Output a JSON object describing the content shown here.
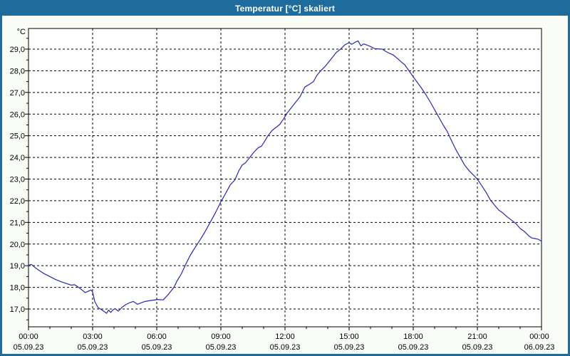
{
  "window": {
    "title": "Temperatur [°C] skaliert"
  },
  "colors": {
    "titlebar_bg": "#1e6c9d",
    "window_border": "#1e6c9d",
    "title_text": "#ffffff",
    "page_bg": "#fafdf7",
    "plot_bg": "#ffffff",
    "grid": "#000000",
    "axis": "#000000",
    "label_text": "#000000",
    "line": "#2828b4"
  },
  "chart": {
    "unit_label": "°C",
    "y_ticks": [
      {
        "value": 29,
        "label": "29,0"
      },
      {
        "value": 28,
        "label": "28,0"
      },
      {
        "value": 27,
        "label": "27,0"
      },
      {
        "value": 26,
        "label": "26,0"
      },
      {
        "value": 25,
        "label": "25,0"
      },
      {
        "value": 24,
        "label": "24,0"
      },
      {
        "value": 23,
        "label": "23,0"
      },
      {
        "value": 22,
        "label": "22,0"
      },
      {
        "value": 21,
        "label": "21,0"
      },
      {
        "value": 20,
        "label": "20,0"
      },
      {
        "value": 19,
        "label": "19,0"
      },
      {
        "value": 18,
        "label": "18,0"
      },
      {
        "value": 17,
        "label": "17,0"
      }
    ],
    "x_ticks": [
      {
        "hour": 0,
        "time": "00:00",
        "date": "05.09.23"
      },
      {
        "hour": 3,
        "time": "03:00",
        "date": "05.09.23"
      },
      {
        "hour": 6,
        "time": "06:00",
        "date": "05.09.23"
      },
      {
        "hour": 9,
        "time": "09:00",
        "date": "05.09.23"
      },
      {
        "hour": 12,
        "time": "12:00",
        "date": "05.09.23"
      },
      {
        "hour": 15,
        "time": "15:00",
        "date": "05.09.23"
      },
      {
        "hour": 18,
        "time": "18:00",
        "date": "05.09.23"
      },
      {
        "hour": 21,
        "time": "21:00",
        "date": "05.09.23"
      },
      {
        "hour": 24,
        "time": "00:00",
        "date": "06.09.23"
      }
    ]
  },
  "chart_data": {
    "type": "line",
    "title": "Temperatur [°C] skaliert",
    "ylabel": "°C",
    "xlabel": "",
    "x_unit": "hours since 05.09.23 00:00",
    "ylim": [
      17.0,
      29.0
    ],
    "xlim_hours": [
      0,
      24
    ],
    "grid": "dashed, horizontal every 1.0 °C, vertical every 3 h",
    "minor_tick_y": 0.5,
    "minor_tick_x_hours": 1,
    "legend": "none",
    "series": [
      {
        "name": "Temperatur [°C]",
        "color": "#2828b4",
        "points": [
          [
            0.0,
            19.02
          ],
          [
            0.13,
            19.06
          ],
          [
            0.3,
            18.92
          ],
          [
            0.5,
            18.78
          ],
          [
            0.75,
            18.62
          ],
          [
            1.0,
            18.5
          ],
          [
            1.25,
            18.37
          ],
          [
            1.5,
            18.27
          ],
          [
            1.8,
            18.17
          ],
          [
            2.0,
            18.1
          ],
          [
            2.15,
            18.12
          ],
          [
            2.35,
            18.0
          ],
          [
            2.5,
            17.88
          ],
          [
            2.65,
            17.76
          ],
          [
            2.8,
            17.82
          ],
          [
            2.93,
            17.88
          ],
          [
            3.0,
            17.78
          ],
          [
            3.1,
            17.35
          ],
          [
            3.25,
            17.07
          ],
          [
            3.4,
            16.98
          ],
          [
            3.55,
            16.88
          ],
          [
            3.65,
            16.8
          ],
          [
            3.75,
            16.95
          ],
          [
            3.85,
            16.84
          ],
          [
            3.95,
            16.96
          ],
          [
            4.05,
            17.02
          ],
          [
            4.2,
            16.9
          ],
          [
            4.4,
            17.1
          ],
          [
            4.55,
            17.2
          ],
          [
            4.75,
            17.3
          ],
          [
            4.9,
            17.35
          ],
          [
            5.1,
            17.22
          ],
          [
            5.3,
            17.3
          ],
          [
            5.45,
            17.35
          ],
          [
            5.65,
            17.38
          ],
          [
            5.85,
            17.41
          ],
          [
            6.05,
            17.44
          ],
          [
            6.3,
            17.42
          ],
          [
            6.55,
            17.68
          ],
          [
            6.8,
            18.0
          ],
          [
            6.95,
            18.3
          ],
          [
            7.15,
            18.62
          ],
          [
            7.35,
            19.05
          ],
          [
            7.55,
            19.45
          ],
          [
            7.8,
            19.85
          ],
          [
            8.0,
            20.15
          ],
          [
            8.25,
            20.55
          ],
          [
            8.5,
            21.0
          ],
          [
            8.75,
            21.45
          ],
          [
            9.0,
            21.95
          ],
          [
            9.2,
            22.3
          ],
          [
            9.45,
            22.75
          ],
          [
            9.65,
            22.95
          ],
          [
            9.85,
            23.4
          ],
          [
            10.0,
            23.65
          ],
          [
            10.15,
            23.75
          ],
          [
            10.35,
            24.0
          ],
          [
            10.55,
            24.25
          ],
          [
            10.75,
            24.45
          ],
          [
            10.9,
            24.52
          ],
          [
            11.05,
            24.75
          ],
          [
            11.2,
            25.0
          ],
          [
            11.4,
            25.25
          ],
          [
            11.6,
            25.4
          ],
          [
            11.75,
            25.52
          ],
          [
            11.95,
            25.8
          ],
          [
            12.1,
            26.05
          ],
          [
            12.3,
            26.3
          ],
          [
            12.5,
            26.55
          ],
          [
            12.7,
            26.8
          ],
          [
            12.93,
            27.25
          ],
          [
            13.1,
            27.35
          ],
          [
            13.33,
            27.5
          ],
          [
            13.5,
            27.8
          ],
          [
            13.67,
            28.0
          ],
          [
            13.85,
            28.17
          ],
          [
            14.0,
            28.35
          ],
          [
            14.2,
            28.6
          ],
          [
            14.4,
            28.85
          ],
          [
            14.6,
            29.0
          ],
          [
            14.8,
            29.2
          ],
          [
            15.0,
            29.3
          ],
          [
            15.12,
            29.22
          ],
          [
            15.3,
            29.33
          ],
          [
            15.42,
            29.38
          ],
          [
            15.55,
            29.15
          ],
          [
            15.68,
            29.24
          ],
          [
            15.85,
            29.18
          ],
          [
            16.0,
            29.12
          ],
          [
            16.2,
            29.02
          ],
          [
            16.55,
            29.0
          ],
          [
            16.7,
            28.9
          ],
          [
            16.9,
            28.8
          ],
          [
            17.05,
            28.74
          ],
          [
            17.25,
            28.58
          ],
          [
            17.45,
            28.4
          ],
          [
            17.6,
            28.28
          ],
          [
            17.8,
            28.0
          ],
          [
            18.0,
            27.72
          ],
          [
            18.2,
            27.45
          ],
          [
            18.4,
            27.18
          ],
          [
            18.6,
            26.88
          ],
          [
            18.8,
            26.55
          ],
          [
            19.0,
            26.2
          ],
          [
            19.2,
            25.85
          ],
          [
            19.4,
            25.5
          ],
          [
            19.6,
            25.18
          ],
          [
            19.8,
            24.75
          ],
          [
            20.0,
            24.35
          ],
          [
            20.2,
            24.0
          ],
          [
            20.4,
            23.65
          ],
          [
            20.6,
            23.4
          ],
          [
            20.8,
            23.2
          ],
          [
            21.0,
            23.0
          ],
          [
            21.2,
            22.7
          ],
          [
            21.4,
            22.4
          ],
          [
            21.6,
            22.05
          ],
          [
            21.8,
            21.8
          ],
          [
            22.0,
            21.57
          ],
          [
            22.2,
            21.43
          ],
          [
            22.4,
            21.25
          ],
          [
            22.6,
            21.1
          ],
          [
            22.8,
            20.95
          ],
          [
            23.0,
            20.72
          ],
          [
            23.2,
            20.58
          ],
          [
            23.4,
            20.38
          ],
          [
            23.55,
            20.28
          ],
          [
            23.7,
            20.25
          ],
          [
            23.85,
            20.22
          ],
          [
            24.0,
            20.13
          ]
        ]
      }
    ]
  }
}
